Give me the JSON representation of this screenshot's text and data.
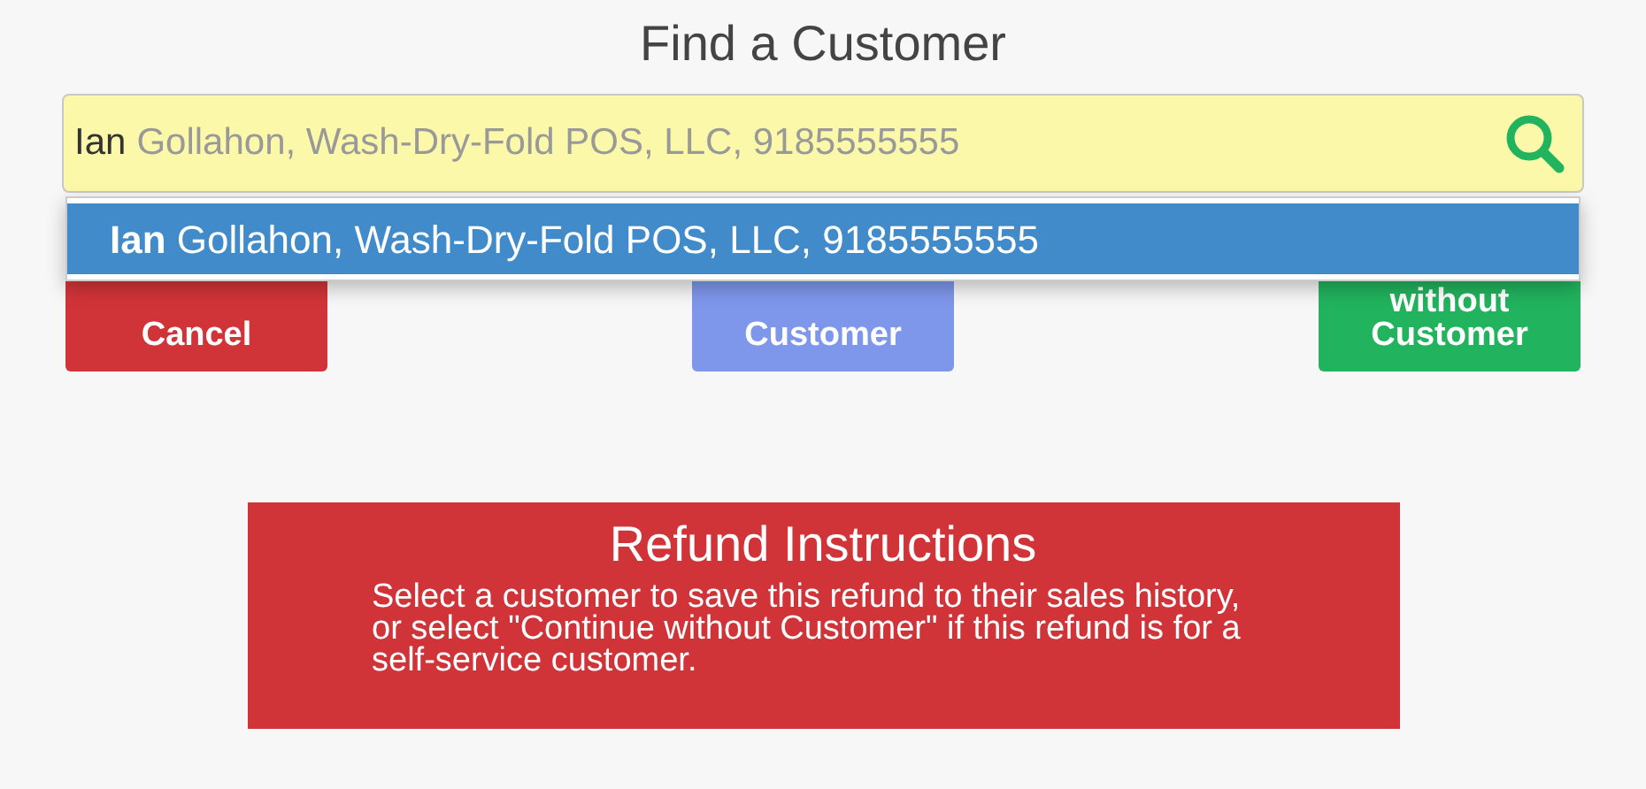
{
  "title": "Find a Customer",
  "search": {
    "value": "Ian",
    "completion": "Gollahon, Wash-Dry-Fold POS, LLC, 9185555555"
  },
  "suggestions": [
    {
      "text": "**Ian** Gollahon, Wash-Dry-Fold POS, LLC, 9185555555",
      "selected": true
    }
  ],
  "buttons": [
    {
      "kind": "cancel",
      "lines": [
        "Cancel"
      ]
    },
    {
      "kind": "add",
      "lines": [
        "Customer"
      ]
    },
    {
      "kind": "continue",
      "lines": [
        "without",
        "Customer"
      ]
    }
  ],
  "instructions": {
    "title": "Refund Instructions",
    "text": "Select a customer to save this refund to their sales history, or select \"Continue without Customer\" if this refund is for a self-service customer."
  }
}
